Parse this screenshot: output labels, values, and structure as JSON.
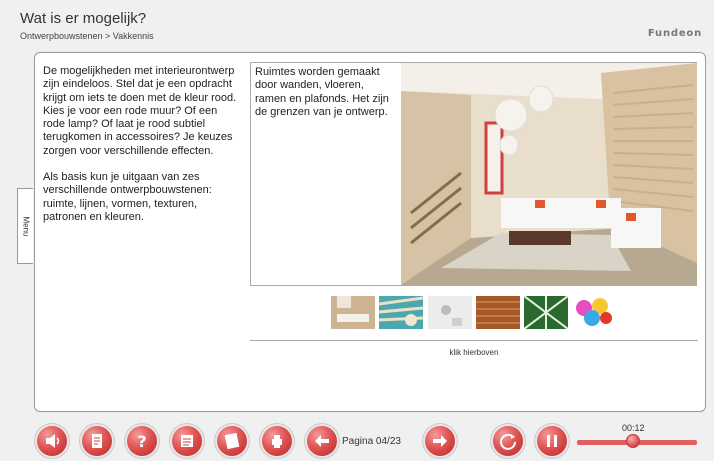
{
  "header": {
    "title": "Wat is er mogelijk?",
    "breadcrumb": "Ontwerpbouwstenen > Vakkennis",
    "logo_main": "Fundeon",
    "logo_letter": "F"
  },
  "sidebar": {
    "menu_label": "Menu"
  },
  "intro": {
    "paragraph1": "De mogelijkheden met interieurontwerp zijn eindeloos. Stel dat je een opdracht krijgt om iets te doen met de kleur rood. Kies je voor een rode muur? Of een rode lamp? Of laat je rood subtiel terugkomen in accessoires? Je keuzes zorgen voor verschillende effecten.",
    "paragraph2": "Als basis kun je uitgaan van zes verschillende ontwerpbouwstenen: ruimte, lijnen, vormen, texturen, patronen en kleuren."
  },
  "feature": {
    "text": "Ruimtes worden gemaakt door wanden, vloeren, ramen en plafonds. Het zijn de grenzen van je ontwerp."
  },
  "thumbnails": [
    {
      "subject": "ruimte"
    },
    {
      "subject": "lijnen"
    },
    {
      "subject": "vormen"
    },
    {
      "subject": "texturen"
    },
    {
      "subject": "patronen"
    },
    {
      "subject": "kleuren"
    }
  ],
  "hint": "klik hierboven",
  "toolbar": {
    "page_label": "Pagina 04/23",
    "time": "00:12",
    "progress": 0.47,
    "accent_color": "#e05454",
    "buttons": [
      {
        "icon": "speaker-icon"
      },
      {
        "icon": "document-icon"
      },
      {
        "icon": "help-icon"
      },
      {
        "icon": "notes-icon"
      },
      {
        "icon": "list-icon"
      },
      {
        "icon": "print-icon"
      },
      {
        "icon": "arrow-left-icon"
      },
      {
        "icon": "arrow-right-icon"
      },
      {
        "icon": "replay-icon"
      },
      {
        "icon": "pause-icon"
      }
    ]
  }
}
